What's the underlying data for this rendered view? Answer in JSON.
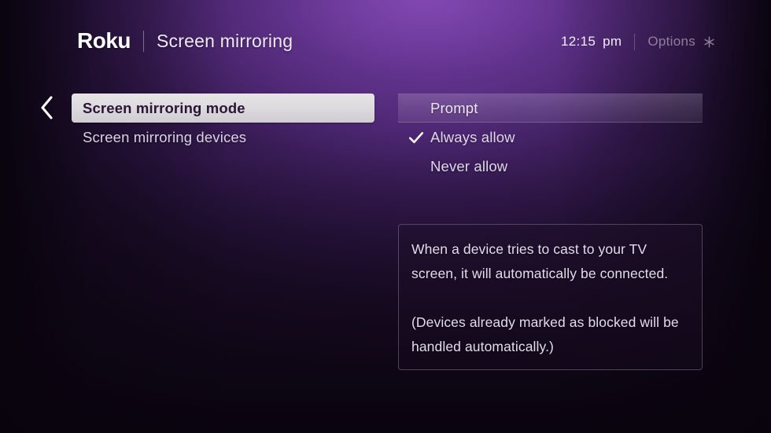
{
  "header": {
    "logo_text": "Roku",
    "page_title": "Screen mirroring",
    "clock_time": "12:15",
    "clock_period": "pm",
    "options_label": "Options",
    "options_icon": "asterisk-star-icon",
    "divider": "|"
  },
  "navigation": {
    "back_icon": "chevron-left-icon"
  },
  "left_menu": {
    "items": [
      {
        "label": "Screen mirroring mode",
        "selected": true
      },
      {
        "label": "Screen mirroring devices",
        "selected": false
      }
    ]
  },
  "options_panel": {
    "items": [
      {
        "label": "Prompt",
        "focused": true,
        "checked": false
      },
      {
        "label": "Always allow",
        "focused": false,
        "checked": true
      },
      {
        "label": "Never allow",
        "focused": false,
        "checked": false
      }
    ],
    "check_icon": "checkmark-icon"
  },
  "description": {
    "paragraphs": [
      "When a device tries to cast to your TV screen, it will automatically be connected.",
      "(Devices already marked as blocked will be handled automatically.)"
    ]
  },
  "colors": {
    "background_bright_purple": "#6f3b9e",
    "background_dark": "#160a21",
    "selected_item_bg": "#e6e4e6",
    "selected_item_text": "#2a1535",
    "primary_text": "#e2dced",
    "dimmed_text": "#8e7f9d",
    "accent_white": "#ffffff"
  }
}
